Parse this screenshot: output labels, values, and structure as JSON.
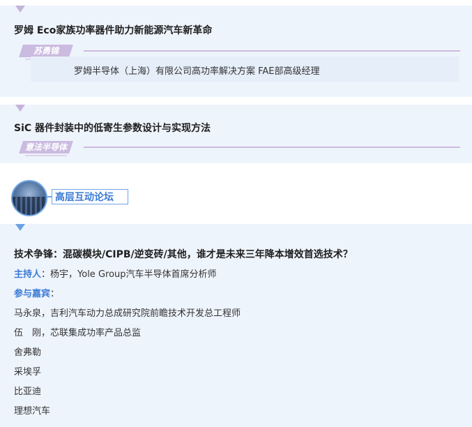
{
  "sessions": [
    {
      "title": "罗姆 Eco家族功率器件助力新能源汽车新革命",
      "speaker": "苏勇锦",
      "affiliation": "罗姆半导体（上海）有限公司高功率解决方案 FAE部高级经理"
    },
    {
      "title": "SiC 器件封装中的低寄生参数设计与实现方法",
      "speaker": "意法半导体"
    }
  ],
  "forum": {
    "label": "高层互动论坛",
    "topic": "技术争锋：混碳模块/CIPB/逆变砖/其他，谁才是未来三年降本增效首选技术？",
    "host_label": "主持人",
    "host_sep": "：",
    "host": "杨宇，Yole Group汽车半导体首席分析师",
    "guests_label": "参与嘉宾",
    "guests_sep": "：",
    "guests": [
      "马永泉，吉利汽车动力总成研究院前瞻技术开发总工程师",
      "伍　刚，芯联集成功率产品总监",
      "舍弗勒",
      "采埃孚",
      "比亚迪",
      "理想汽车"
    ]
  },
  "colors": {
    "card_bg": "#eef4fc",
    "purple_accent": "#cbbbe0",
    "blue_accent": "#3a7bd5"
  }
}
